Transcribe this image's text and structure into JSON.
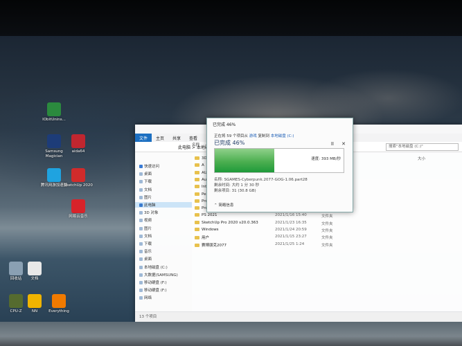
{
  "desktop_icons": [
    {
      "label": "IObitUnins...",
      "icon": "iobit-uninstaller-icon",
      "color": "#2b8a3e"
    },
    {
      "label": "Samsung Magician",
      "icon": "samsung-magician-icon",
      "color": "#1d3c78"
    },
    {
      "label": "aida64",
      "icon": "aida64-icon",
      "color": "#c0262f"
    },
    {
      "label": "腾讯网游加速器",
      "icon": "game-accelerator-icon",
      "color": "#1fa3e0"
    },
    {
      "label": "SketchUp 2020",
      "icon": "sketchup-icon",
      "color": "#d12b2b"
    },
    {
      "label": "网易云音乐",
      "icon": "netease-music-icon",
      "color": "#d8232a"
    },
    {
      "label": "回收站",
      "icon": "recycle-bin-icon",
      "color": "#8aa0b3"
    },
    {
      "label": "文档",
      "icon": "document-icon",
      "color": "#e8e8e8"
    },
    {
      "label": "CPU-Z",
      "icon": "cpuz-icon",
      "color": "#556b2f"
    },
    {
      "label": "NN",
      "icon": "nn-icon",
      "color": "#f0b400"
    },
    {
      "label": "Everything",
      "icon": "everything-icon",
      "color": "#f07a00"
    }
  ],
  "explorer": {
    "tabs": [
      "文件",
      "主页",
      "共享",
      "查看"
    ],
    "address": "此电脑 > 本地磁盘 (C:)",
    "search_placeholder": "搜索\"本地磁盘 (C:)\"",
    "column_name": "名称",
    "column_size": "大小",
    "nav": [
      {
        "label": "快速访问",
        "sel": false
      },
      {
        "label": "桌面",
        "sel": false
      },
      {
        "label": "下载",
        "sel": false
      },
      {
        "label": "文档",
        "sel": false
      },
      {
        "label": "图片",
        "sel": false
      },
      {
        "label": "此电脑",
        "sel": true
      },
      {
        "label": "3D 对象",
        "sel": false
      },
      {
        "label": "视频",
        "sel": false
      },
      {
        "label": "图片",
        "sel": false
      },
      {
        "label": "文档",
        "sel": false
      },
      {
        "label": "下载",
        "sel": false
      },
      {
        "label": "音乐",
        "sel": false
      },
      {
        "label": "桌面",
        "sel": false
      },
      {
        "label": "本地磁盘 (C:)",
        "sel": false
      },
      {
        "label": "大数据(SAMSUNG)",
        "sel": false
      },
      {
        "label": "移动硬盘 (F:)",
        "sel": false
      },
      {
        "label": "移动硬盘 (F:)",
        "sel": false
      },
      {
        "label": "网络",
        "sel": false
      }
    ],
    "files": [
      {
        "name": "3D",
        "date": "",
        "type": ""
      },
      {
        "name": "A",
        "date": "",
        "type": ""
      },
      {
        "name": "AU",
        "date": "",
        "type": ""
      },
      {
        "name": "Auto",
        "date": "",
        "type": ""
      },
      {
        "name": "Inte",
        "date": "",
        "type": ""
      },
      {
        "name": "Perf",
        "date": "",
        "type": ""
      },
      {
        "name": "Program Files",
        "date": "2021/1/24 14:48",
        "type": "文件夹"
      },
      {
        "name": "Program Files (x86)",
        "date": "2021/1/16 20:49",
        "type": "文件夹"
      },
      {
        "name": "PS 2021",
        "date": "2021/1/16 15:40",
        "type": "文件夹"
      },
      {
        "name": "SketchUp Pro 2020 v20.0.363",
        "date": "2021/1/23 16:35",
        "type": "文件夹"
      },
      {
        "name": "Windows",
        "date": "2021/1/24 20:59",
        "type": "文件夹"
      },
      {
        "name": "用户",
        "date": "2021/1/15 23:27",
        "type": "文件夹"
      },
      {
        "name": "赛博朋克2077",
        "date": "2021/1/25 1:24",
        "type": "文件夹"
      }
    ],
    "status": "13 个项目"
  },
  "copy_dialog": {
    "title": "已完成 46%",
    "line1_prefix": "正在将 59 个项目从",
    "line1_src": "游戏",
    "line1_mid": "复制到",
    "line1_dst": "本地磁盘 (C:)",
    "heading": "已完成 46%",
    "pause_label": "II",
    "close_label": "✕",
    "speed": "速度: 393 MB/秒",
    "progress": 0.46,
    "name_line": "名称: SGAMES-Cyberpunk.2077-GOG-1.06.part28",
    "time_line": "剩余时间: 大约 1 分 30 秒",
    "items_line": "剩余项目: 31 (30.8 GB)",
    "less_details": "简略信息"
  }
}
